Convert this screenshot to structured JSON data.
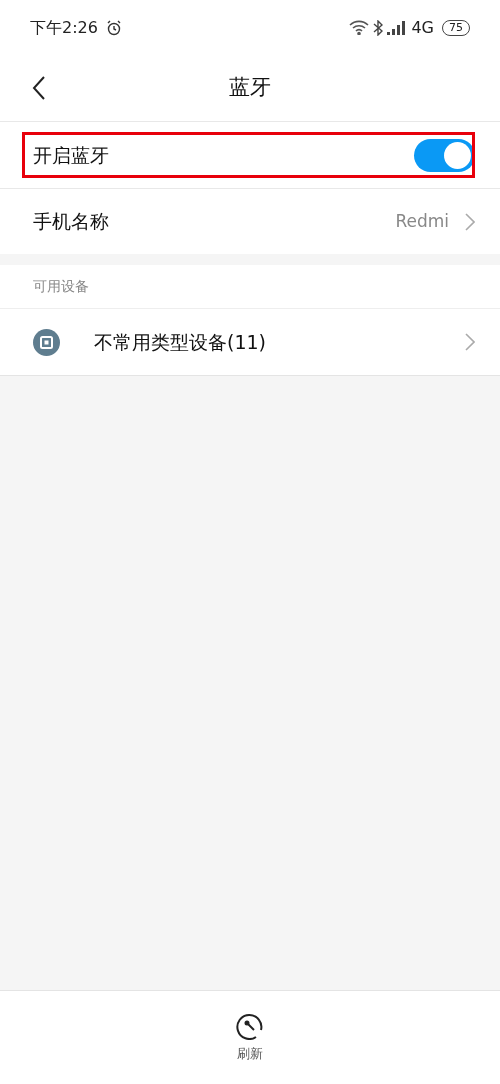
{
  "status_bar": {
    "time": "下午2:26",
    "network": "4G",
    "battery": "75"
  },
  "header": {
    "title": "蓝牙"
  },
  "settings": [
    {
      "kind": "toggle",
      "label": "开启蓝牙",
      "on": true,
      "highlighted": true
    },
    {
      "kind": "link",
      "label": "手机名称",
      "value": "Redmi",
      "highlighted": false
    }
  ],
  "section": {
    "title": "可用设备",
    "devices": [
      {
        "label": "不常用类型设备(11)"
      }
    ]
  },
  "bottom_bar": {
    "label": "刷新"
  }
}
